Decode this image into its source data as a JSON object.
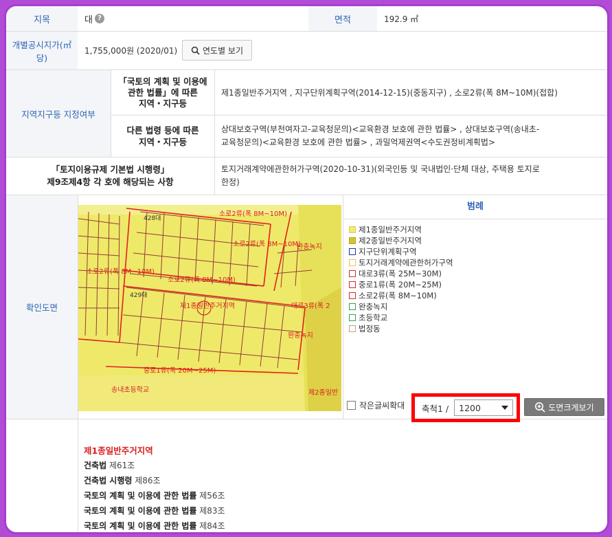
{
  "rows": {
    "jimok_label": "지목",
    "jimok_value": "대",
    "jimok_help": "?",
    "area_label": "면적",
    "area_value": "192.9 ㎡",
    "price_label_line1": "개별공시지가(㎡",
    "price_label_line2": "당)",
    "price_value": "1,755,000원 (2020/01)",
    "yearly_button": "연도별 보기",
    "zone_label": "지역지구등 지정여부",
    "law1_label_line1": "「국토의 계획 및 이용에",
    "law1_label_line2": "관한 법률」에 따른",
    "law1_label_line3": "지역・지구등",
    "law1_value": "제1종일반주거지역 , 지구단위계획구역(2014-12-15)(중동지구) , 소로2류(폭 8M~10M)(접합)",
    "law2_label_line1": "다른 법령 등에 따른",
    "law2_label_line2": "지역・지구등",
    "law2_value_line1": "상대보호구역(부천여자고-교육청문의)<교육환경 보호에 관한 법률> , 상대보호구역(송내초-",
    "law2_value_line2": "교육청문의)<교육환경 보호에 관한 법률> , 과밀억제권역<수도권정비계획법>",
    "enforce_label_line1": "「토지이용규제 기본법 시행령」",
    "enforce_label_line2": "제9조제4항 각 호에 해당되는 사항",
    "enforce_value_line1": "토지거래계약에관한허가구역(2020-10-31)(외국인등 및 국내법인·단체 대상, 주택용 토지로",
    "enforce_value_line2": "한정)",
    "map_label": "확인도면"
  },
  "legend": {
    "title": "범례",
    "items": [
      {
        "label": "제1종일반주거지역",
        "fill": "#f1ea7a",
        "border": "#d8cf4f"
      },
      {
        "label": "제2종일반주거지역",
        "fill": "#d6c233",
        "border": "#b9a71e"
      },
      {
        "label": "지구단위계획구역",
        "fill": "#ffffff",
        "border": "#1a2fb5"
      },
      {
        "label": "토지거래계약에관한허가구역",
        "fill": "#ffffff",
        "border": "#f0c060"
      },
      {
        "label": "대로3류(폭 25M~30M)",
        "fill": "#ffffff",
        "border": "#d62a2a"
      },
      {
        "label": "중로1류(폭 20M~25M)",
        "fill": "#ffffff",
        "border": "#d62a2a"
      },
      {
        "label": "소로2류(폭 8M~10M)",
        "fill": "#ffffff",
        "border": "#d62a2a"
      },
      {
        "label": "완충녹지",
        "fill": "#ffffff",
        "border": "#3aa04a"
      },
      {
        "label": "초등학교",
        "fill": "#ffffff",
        "border": "#3aa04a"
      },
      {
        "label": "법정동",
        "fill": "#ffffff",
        "border": "#b8a880"
      }
    ]
  },
  "map_labels": {
    "road_top": "소로2류(폭 8M~10M)",
    "road_mid": "소로2류(폭 8M~10M)",
    "road_left": "소로2류(폭 8M~10M)",
    "road_center": "소로2류(폭 8M~10M)",
    "zone_center": "제1종일반주거지역",
    "road_right": "대로3류(폭 2",
    "buffer_green": "완충녹지",
    "buffer_green2": "완충녹지",
    "road_bottom": "중로1류(폭 20M~25M)",
    "school": "송내초등학교",
    "zone2": "제2종일반",
    "lot_428": "428대",
    "lot_429": "429대"
  },
  "controls": {
    "small_text_label": "작은글씨확대",
    "scale_label": "축척1 /",
    "scale_value": "1200",
    "big_map_button": "도면크게보기"
  },
  "laws": {
    "zone_title": "제1종일반주거지역",
    "items": [
      {
        "name": "건축법",
        "article": "제61조"
      },
      {
        "name": "건축법 시행령",
        "article": "제86조"
      },
      {
        "name": "국토의 계획 및 이용에 관한 법률",
        "article": "제56조"
      },
      {
        "name": "국토의 계획 및 이용에 관한 법률",
        "article": "제83조"
      },
      {
        "name": "국토의 계획 및 이용에 관한 법률",
        "article": "제84조"
      }
    ]
  },
  "colors": {
    "label_blue": "#2e64b5",
    "highlight_red": "#ff0000",
    "frame_purple": "#b24bd6"
  }
}
